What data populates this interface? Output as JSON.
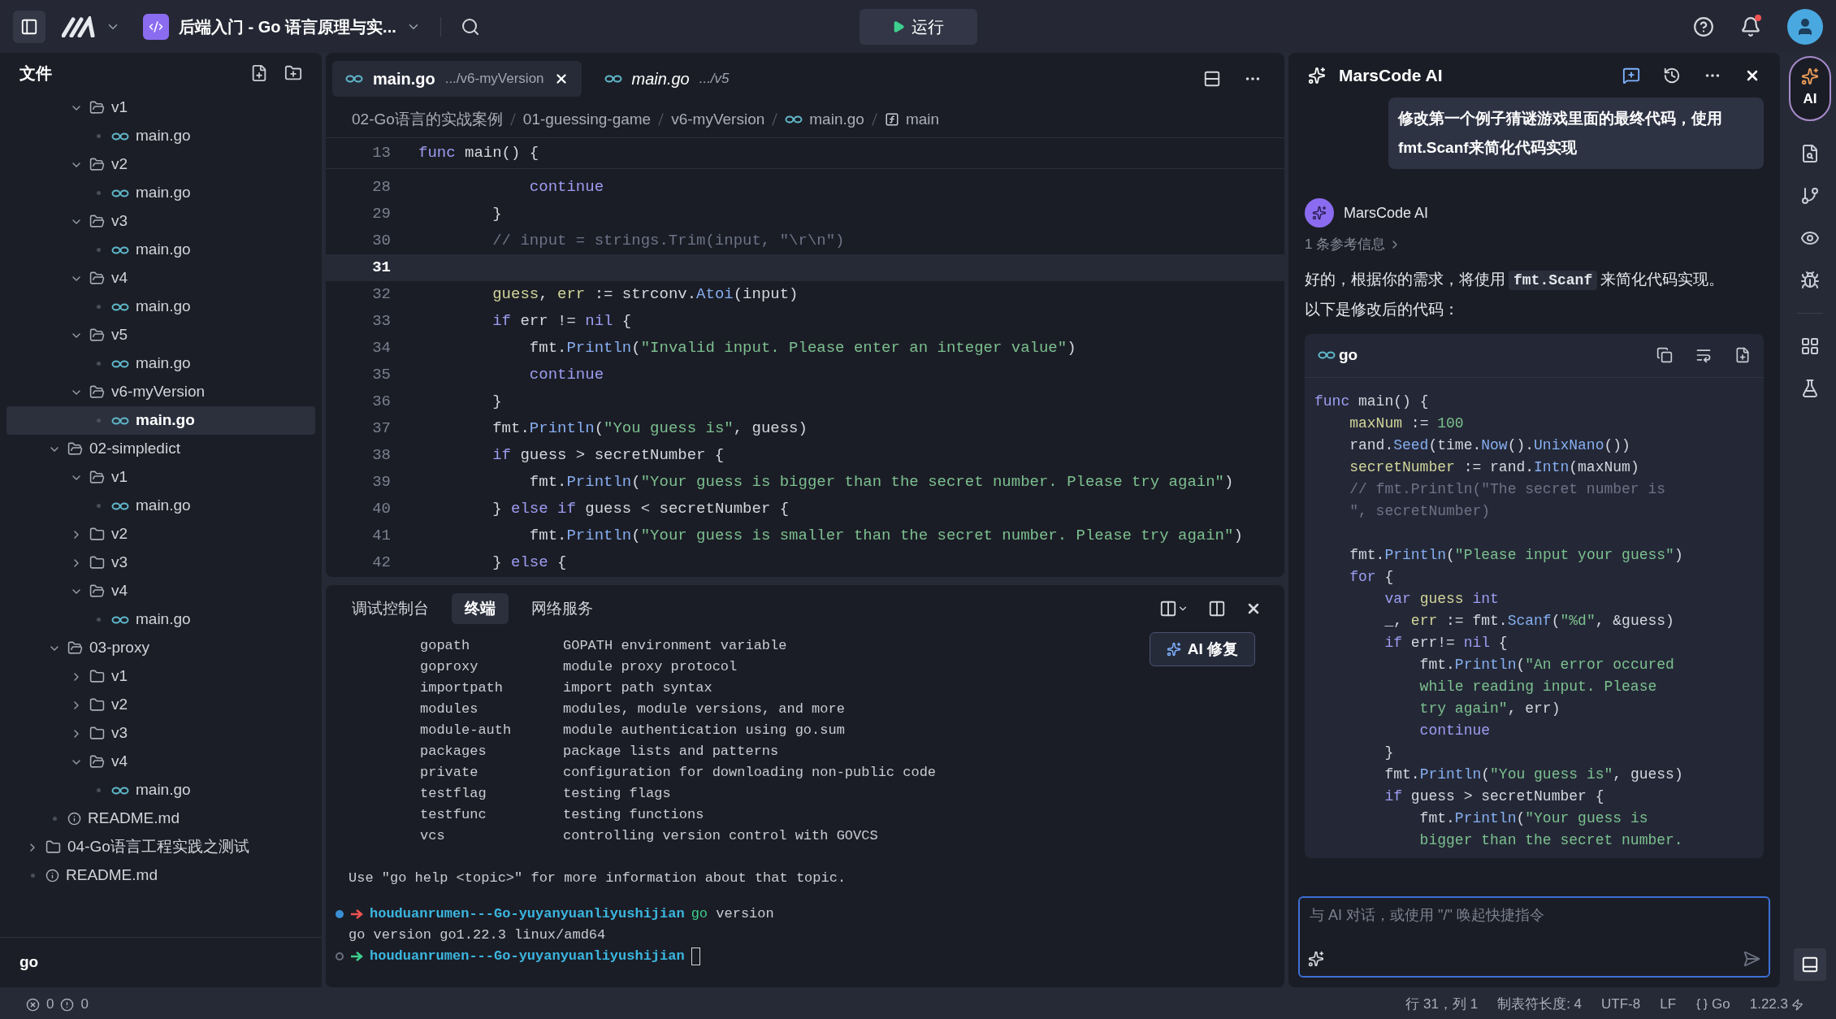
{
  "topbar": {
    "project_title": "后端入门 - Go 语言原理与实...",
    "run_label": "运行",
    "notification_dot": true
  },
  "sidebar": {
    "title": "文件",
    "tree": [
      {
        "kind": "hidden",
        "children": [
          {
            "kind": "hidden",
            "children": [
              {
                "name": "v1",
                "kind": "folder",
                "expanded": true,
                "selected": false,
                "children": [
                  {
                    "name": "main.go",
                    "kind": "go",
                    "selected": false
                  }
                ]
              },
              {
                "name": "v2",
                "kind": "folder",
                "expanded": true,
                "selected": false,
                "children": [
                  {
                    "name": "main.go",
                    "kind": "go",
                    "selected": false
                  }
                ]
              },
              {
                "name": "v3",
                "kind": "folder",
                "expanded": true,
                "selected": false,
                "children": [
                  {
                    "name": "main.go",
                    "kind": "go",
                    "selected": false
                  }
                ]
              },
              {
                "name": "v4",
                "kind": "folder",
                "expanded": true,
                "selected": false,
                "children": [
                  {
                    "name": "main.go",
                    "kind": "go",
                    "selected": false
                  }
                ]
              },
              {
                "name": "v5",
                "kind": "folder",
                "expanded": true,
                "selected": false,
                "children": [
                  {
                    "name": "main.go",
                    "kind": "go",
                    "selected": false
                  }
                ]
              },
              {
                "name": "v6-myVersion",
                "kind": "folder",
                "expanded": true,
                "selected": false,
                "children": [
                  {
                    "name": "main.go",
                    "kind": "go",
                    "selected": true
                  }
                ]
              }
            ]
          },
          {
            "name": "02-simpledict",
            "kind": "folder",
            "expanded": true,
            "selected": false,
            "children": [
              {
                "name": "v1",
                "kind": "folder",
                "expanded": true,
                "selected": false,
                "children": [
                  {
                    "name": "main.go",
                    "kind": "go",
                    "selected": false
                  }
                ]
              },
              {
                "name": "v2",
                "kind": "folder",
                "expanded": false,
                "selected": false
              },
              {
                "name": "v3",
                "kind": "folder",
                "expanded": false,
                "selected": false
              },
              {
                "name": "v4",
                "kind": "folder",
                "expanded": true,
                "selected": false,
                "children": [
                  {
                    "name": "main.go",
                    "kind": "go",
                    "selected": false
                  }
                ]
              }
            ]
          },
          {
            "name": "03-proxy",
            "kind": "folder",
            "expanded": true,
            "selected": false,
            "children": [
              {
                "name": "v1",
                "kind": "folder",
                "expanded": false,
                "selected": false
              },
              {
                "name": "v2",
                "kind": "folder",
                "expanded": false,
                "selected": false
              },
              {
                "name": "v3",
                "kind": "folder",
                "expanded": false,
                "selected": false
              },
              {
                "name": "v4",
                "kind": "folder",
                "expanded": true,
                "selected": false,
                "children": [
                  {
                    "name": "main.go",
                    "kind": "go",
                    "selected": false
                  }
                ]
              }
            ]
          },
          {
            "name": "README.md",
            "kind": "markdown",
            "selected": false
          }
        ]
      },
      {
        "name": "04-Go语言工程实践之测试",
        "kind": "folder",
        "expanded": false,
        "selected": false
      },
      {
        "name": "README.md",
        "kind": "markdown",
        "selected": false
      }
    ],
    "outline_title": "go"
  },
  "editor": {
    "tabs": [
      {
        "name": "main.go",
        "path": ".../v6-myVersion",
        "selected": true,
        "preview": false
      },
      {
        "name": "main.go",
        "path": ".../v5",
        "selected": false,
        "preview": true
      }
    ],
    "breadcrumbs": [
      {
        "text": "02-Go语言的实战案例",
        "kind": "folder"
      },
      {
        "text": "01-guessing-game",
        "kind": "folder"
      },
      {
        "text": "v6-myVersion",
        "kind": "folder"
      },
      {
        "text": "main.go",
        "kind": "go"
      },
      {
        "text": "main",
        "kind": "function"
      }
    ],
    "sticky_line": {
      "no": "13",
      "tokens": [
        {
          "kind": "kw",
          "text": "func "
        },
        {
          "kind": "plain",
          "text": "main() {"
        }
      ]
    },
    "lines": [
      {
        "no": "28",
        "current": false,
        "tokens": [
          {
            "kind": "kw",
            "text": "            continue"
          }
        ]
      },
      {
        "no": "29",
        "current": false,
        "tokens": [
          {
            "kind": "plain",
            "text": "        }"
          }
        ]
      },
      {
        "no": "30",
        "current": false,
        "tokens": [
          {
            "kind": "cmt",
            "text": "        // input = strings.Trim(input, \"\\r\\n\")"
          }
        ]
      },
      {
        "no": "31",
        "current": true
      },
      {
        "no": "32",
        "current": false,
        "tokens": [
          {
            "kind": "var",
            "text": "        guess"
          },
          {
            "kind": "plain",
            "text": ", "
          },
          {
            "kind": "var",
            "text": "err"
          },
          {
            "kind": "plain",
            "text": " := strconv."
          },
          {
            "kind": "fn",
            "text": "Atoi"
          },
          {
            "kind": "plain",
            "text": "(input)"
          }
        ]
      },
      {
        "no": "33",
        "current": false,
        "tokens": [
          {
            "kind": "kw",
            "text": "        if"
          },
          {
            "kind": "plain",
            "text": " err != "
          },
          {
            "kind": "kw",
            "text": "nil"
          },
          {
            "kind": "plain",
            "text": " {"
          }
        ]
      },
      {
        "no": "34",
        "current": false,
        "tokens": [
          {
            "kind": "plain",
            "text": "            fmt."
          },
          {
            "kind": "fn",
            "text": "Println"
          },
          {
            "kind": "plain",
            "text": "("
          },
          {
            "kind": "str",
            "text": "\"Invalid input. Please enter an integer value\""
          },
          {
            "kind": "plain",
            "text": ")"
          }
        ]
      },
      {
        "no": "35",
        "current": false,
        "tokens": [
          {
            "kind": "kw",
            "text": "            continue"
          }
        ]
      },
      {
        "no": "36",
        "current": false,
        "tokens": [
          {
            "kind": "plain",
            "text": "        }"
          }
        ]
      },
      {
        "no": "37",
        "current": false,
        "tokens": [
          {
            "kind": "plain",
            "text": "        fmt."
          },
          {
            "kind": "fn",
            "text": "Println"
          },
          {
            "kind": "plain",
            "text": "("
          },
          {
            "kind": "str",
            "text": "\"You guess is\""
          },
          {
            "kind": "plain",
            "text": ", guess)"
          }
        ]
      },
      {
        "no": "38",
        "current": false,
        "tokens": [
          {
            "kind": "kw",
            "text": "        if"
          },
          {
            "kind": "plain",
            "text": " guess > secretNumber {"
          }
        ]
      },
      {
        "no": "39",
        "current": false,
        "tokens": [
          {
            "kind": "plain",
            "text": "            fmt."
          },
          {
            "kind": "fn",
            "text": "Println"
          },
          {
            "kind": "plain",
            "text": "("
          },
          {
            "kind": "str",
            "text": "\"Your guess is bigger than the secret number. Please try again\""
          },
          {
            "kind": "plain",
            "text": ")"
          }
        ]
      },
      {
        "no": "40",
        "current": false,
        "tokens": [
          {
            "kind": "plain",
            "text": "        } "
          },
          {
            "kind": "kw",
            "text": "else if"
          },
          {
            "kind": "plain",
            "text": " guess < secretNumber {"
          }
        ]
      },
      {
        "no": "41",
        "current": false,
        "tokens": [
          {
            "kind": "plain",
            "text": "            fmt."
          },
          {
            "kind": "fn",
            "text": "Println"
          },
          {
            "kind": "plain",
            "text": "("
          },
          {
            "kind": "str",
            "text": "\"Your guess is smaller than the secret number. Please try again\""
          },
          {
            "kind": "plain",
            "text": ")"
          }
        ]
      },
      {
        "no": "42",
        "current": false,
        "tokens": [
          {
            "kind": "plain",
            "text": "        } "
          },
          {
            "kind": "kw",
            "text": "else"
          },
          {
            "kind": "plain",
            "text": " {"
          }
        ]
      }
    ]
  },
  "terminal": {
    "tabs": [
      {
        "label": "调试控制台",
        "selected": false
      },
      {
        "label": "终端",
        "selected": true
      },
      {
        "label": "网络服务",
        "selected": false
      }
    ],
    "fix_button": "AI 修复",
    "help_rows": [
      {
        "topic": "gopath",
        "desc": "GOPATH environment variable"
      },
      {
        "topic": "goproxy",
        "desc": "module proxy protocol"
      },
      {
        "topic": "importpath",
        "desc": "import path syntax"
      },
      {
        "topic": "modules",
        "desc": "modules, module versions, and more"
      },
      {
        "topic": "module-auth",
        "desc": "module authentication using go.sum"
      },
      {
        "topic": "packages",
        "desc": "package lists and patterns"
      },
      {
        "topic": "private",
        "desc": "configuration for downloading non-public code"
      },
      {
        "topic": "testflag",
        "desc": "testing flags"
      },
      {
        "topic": "testfunc",
        "desc": "testing functions"
      },
      {
        "topic": "vcs",
        "desc": "controlling version control with GOVCS"
      }
    ],
    "note": "Use \"go help <topic>\" for more information about that topic.",
    "session": [
      {
        "kind": "prompt",
        "finished": true,
        "ok": false,
        "path": "houduanrumen---Go-yuyanyuanliyushijian",
        "command": "go",
        "args": "version"
      },
      {
        "kind": "output",
        "text": "go version go1.22.3 linux/amd64"
      },
      {
        "kind": "prompt",
        "finished": false,
        "ok": true,
        "path": "houduanrumen---Go-yuyanyuanliyushijian",
        "cursor": true
      }
    ]
  },
  "ai": {
    "title": "MarsCode AI",
    "user_message": "修改第一个例子猜谜游戏里面的最终代码，使用fmt.Scanf来简化代码实现",
    "assistant_name": "MarsCode AI",
    "references": "1 条参考信息",
    "reply": {
      "before": "好的，根据你的需求，将使用",
      "code": "fmt.Scanf",
      "after": "来简化代码实现。以下是修改后的代码："
    },
    "code_block": {
      "language": "go",
      "lines": [
        {
          "kind": "code",
          "tokens": [
            {
              "kind": "kw",
              "text": "func "
            },
            {
              "kind": "plain",
              "text": "main() {"
            }
          ]
        },
        {
          "kind": "code",
          "tokens": [
            {
              "kind": "var",
              "text": "    maxNum"
            },
            {
              "kind": "plain",
              "text": " := "
            },
            {
              "kind": "num",
              "text": "100"
            }
          ]
        },
        {
          "kind": "code",
          "tokens": [
            {
              "kind": "plain",
              "text": "    rand."
            },
            {
              "kind": "fn",
              "text": "Seed"
            },
            {
              "kind": "plain",
              "text": "(time."
            },
            {
              "kind": "fn",
              "text": "Now"
            },
            {
              "kind": "plain",
              "text": "()."
            },
            {
              "kind": "fn",
              "text": "UnixNano"
            },
            {
              "kind": "plain",
              "text": "())"
            }
          ]
        },
        {
          "kind": "code",
          "tokens": [
            {
              "kind": "var",
              "text": "    secretNumber"
            },
            {
              "kind": "plain",
              "text": " := rand."
            },
            {
              "kind": "fn",
              "text": "Intn"
            },
            {
              "kind": "plain",
              "text": "(maxNum)"
            }
          ]
        },
        {
          "kind": "code",
          "tokens": [
            {
              "kind": "cmt",
              "text": "    // fmt.Println(\"The secret number is"
            }
          ]
        },
        {
          "kind": "code",
          "tokens": [
            {
              "kind": "cmt",
              "text": "    \", secretNumber)"
            }
          ]
        },
        {
          "kind": "blank"
        },
        {
          "kind": "code",
          "tokens": [
            {
              "kind": "plain",
              "text": "    fmt."
            },
            {
              "kind": "fn",
              "text": "Println"
            },
            {
              "kind": "plain",
              "text": "("
            },
            {
              "kind": "str",
              "text": "\"Please input your guess\""
            },
            {
              "kind": "plain",
              "text": ")"
            }
          ]
        },
        {
          "kind": "code",
          "tokens": [
            {
              "kind": "kw",
              "text": "    for"
            },
            {
              "kind": "plain",
              "text": " {"
            }
          ]
        },
        {
          "kind": "code",
          "tokens": [
            {
              "kind": "kw",
              "text": "        var "
            },
            {
              "kind": "var",
              "text": "guess "
            },
            {
              "kind": "kw",
              "text": "int"
            }
          ]
        },
        {
          "kind": "code",
          "tokens": [
            {
              "kind": "plain",
              "text": "        _, "
            },
            {
              "kind": "var",
              "text": "err"
            },
            {
              "kind": "plain",
              "text": " := fmt."
            },
            {
              "kind": "fn",
              "text": "Scanf"
            },
            {
              "kind": "plain",
              "text": "("
            },
            {
              "kind": "str",
              "text": "\"%d\""
            },
            {
              "kind": "plain",
              "text": ", &guess)"
            }
          ]
        },
        {
          "kind": "code",
          "tokens": [
            {
              "kind": "kw",
              "text": "        if"
            },
            {
              "kind": "plain",
              "text": " err!= "
            },
            {
              "kind": "kw",
              "text": "nil"
            },
            {
              "kind": "plain",
              "text": " {"
            }
          ]
        },
        {
          "kind": "code",
          "tokens": [
            {
              "kind": "plain",
              "text": "            fmt."
            },
            {
              "kind": "fn",
              "text": "Println"
            },
            {
              "kind": "plain",
              "text": "("
            },
            {
              "kind": "str",
              "text": "\"An error occured"
            }
          ]
        },
        {
          "kind": "code",
          "tokens": [
            {
              "kind": "str",
              "text": "            while reading input. Please"
            }
          ]
        },
        {
          "kind": "code",
          "tokens": [
            {
              "kind": "str",
              "text": "            try again\""
            },
            {
              "kind": "plain",
              "text": ", err)"
            }
          ]
        },
        {
          "kind": "code",
          "tokens": [
            {
              "kind": "kw",
              "text": "            continue"
            }
          ]
        },
        {
          "kind": "code",
          "tokens": [
            {
              "kind": "plain",
              "text": "        }"
            }
          ]
        },
        {
          "kind": "code",
          "tokens": [
            {
              "kind": "plain",
              "text": "        fmt."
            },
            {
              "kind": "fn",
              "text": "Println"
            },
            {
              "kind": "plain",
              "text": "("
            },
            {
              "kind": "str",
              "text": "\"You guess is\""
            },
            {
              "kind": "plain",
              "text": ", guess)"
            }
          ]
        },
        {
          "kind": "code",
          "tokens": [
            {
              "kind": "kw",
              "text": "        if"
            },
            {
              "kind": "plain",
              "text": " guess > secretNumber {"
            }
          ]
        },
        {
          "kind": "code",
          "tokens": [
            {
              "kind": "plain",
              "text": "            fmt."
            },
            {
              "kind": "fn",
              "text": "Println"
            },
            {
              "kind": "plain",
              "text": "("
            },
            {
              "kind": "str",
              "text": "\"Your guess is"
            }
          ]
        },
        {
          "kind": "code",
          "tokens": [
            {
              "kind": "str",
              "text": "            bigger than the secret number."
            }
          ]
        }
      ]
    },
    "input_placeholder": "与 AI 对话，或使用 \"/\" 唤起快捷指令"
  },
  "rail": {
    "ai_label": "AI",
    "ai_selected": true
  },
  "status_bar": {
    "errors": "0",
    "warnings": "0",
    "cursor": "行 31，列 1",
    "tab_size": "制表符长度: 4",
    "encoding": "UTF-8",
    "eol": "LF",
    "language": "Go",
    "version": "1.22.3"
  }
}
